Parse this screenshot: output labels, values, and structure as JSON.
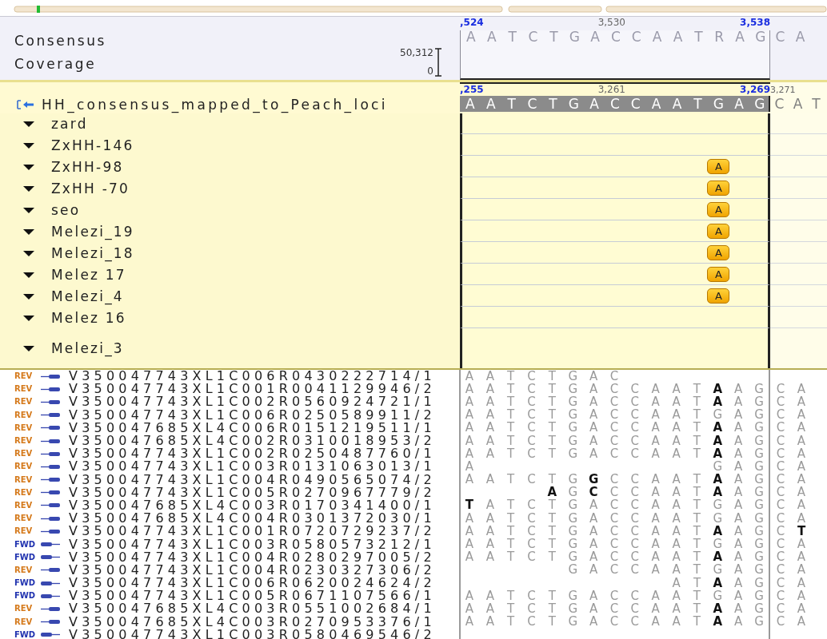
{
  "consensus": {
    "label": "Consensus",
    "coverage_label": "Coverage",
    "coverage_max": "50,312",
    "coverage_min": "0",
    "ruler": [
      {
        "label": ",524",
        "kind": "major"
      },
      {
        "label": "3,530",
        "kind": "minor"
      },
      {
        "label": "3,538",
        "kind": "major"
      }
    ],
    "sequence": "A A T C T G A C C A A T R A G",
    "overhang": "C A"
  },
  "reference": {
    "name": "HH_consensus_mapped_to_Peach_loci",
    "ruler": [
      {
        "label": ",255",
        "kind": "major"
      },
      {
        "label": "3,261",
        "kind": "minor"
      },
      {
        "label": "3,269",
        "kind": "major"
      }
    ],
    "overhang_ruler": "3,271",
    "sequence": "A A T C T G A C C A A T G A G",
    "overhang": "C A T"
  },
  "samples": [
    {
      "name": "zard",
      "expanded": true
    },
    {
      "name": "ZxHH-146",
      "expanded": true
    },
    {
      "name": "ZxHH-98",
      "expanded": true,
      "calls": "                        A"
    },
    {
      "name": "ZxHH -70",
      "expanded": true,
      "calls": "                        A"
    },
    {
      "name": "seo",
      "expanded": true,
      "calls": "                        A"
    },
    {
      "name": "Melezi_19",
      "expanded": true,
      "calls": "                        A"
    },
    {
      "name": "Melezi_18",
      "expanded": true,
      "calls": "                        A"
    },
    {
      "name": "Melez 17",
      "expanded": true,
      "calls": "                        A"
    },
    {
      "name": "Melezi_4",
      "expanded": true,
      "calls": "                        A"
    },
    {
      "name": "Melez 16",
      "expanded": true
    },
    {
      "name": "Melezi_3",
      "expanded": true
    }
  ],
  "reads": [
    {
      "strand": "REV",
      "kind": "reverse",
      "name": "V350047743XL1C006R0430222714/1",
      "bases": [
        "A A T C T G A C"
      ]
    },
    {
      "strand": "REV",
      "kind": "reverse",
      "name": "V350047743XL1C001R0041129946/2",
      "bases": [
        "A A T C T G A C C A A T **A** A G"
      ],
      "overhang": "C A"
    },
    {
      "strand": "REV",
      "kind": "reverse",
      "name": "V350047743XL1C002R0560924721/1",
      "bases": [
        "A A T C T G A C C A A T **A** A G"
      ],
      "overhang": "C A"
    },
    {
      "strand": "REV",
      "kind": "reverse",
      "name": "V350047743XL1C006R0250589911/2",
      "bases": [
        "A A T C T G A C C A A T G A G"
      ],
      "overhang": "C A"
    },
    {
      "strand": "REV",
      "kind": "reverse",
      "name": "V350047685XL4C006R0151219511/1",
      "bases": [
        "A A T C T G A C C A A T **A** A G"
      ],
      "overhang": "C A"
    },
    {
      "strand": "REV",
      "kind": "reverse",
      "name": "V350047685XL4C002R0310018953/2",
      "bases": [
        "A A T C T G A C C A A T **A** A G"
      ],
      "overhang": "C A"
    },
    {
      "strand": "REV",
      "kind": "reverse",
      "name": "V350047743XL1C002R0250487760/1",
      "bases": [
        "A A T C T G A C C A A T **A** A G"
      ],
      "overhang": "C A"
    },
    {
      "strand": "REV",
      "kind": "reverse",
      "name": "V350047743XL1C003R0131063013/1",
      "bases": [
        "A",
        "                      G A G"
      ],
      "overhang": "C A"
    },
    {
      "strand": "REV",
      "kind": "reverse",
      "name": "V350047743XL1C004R0490565074/2",
      "bases": [
        "A A T C T G **G** C C A A T **A** A G"
      ],
      "overhang": "C A"
    },
    {
      "strand": "REV",
      "kind": "reverse",
      "name": "V350047743XL1C005R0270967779/2",
      "bases": [
        "        **A** G **C** C C A A T **A** A G"
      ],
      "overhang": "C A"
    },
    {
      "strand": "REV",
      "kind": "reverse",
      "name": "V350047685XL4C003R0170341400/1",
      "bases": [
        "**T** A T C T G A C C A A T G A G"
      ],
      "overhang": "C A"
    },
    {
      "strand": "REV",
      "kind": "reverse",
      "name": "V350047685XL4C004R0301372030/1",
      "bases": [
        "A A T C T G A C C A A T G A G"
      ],
      "overhang": "C A"
    },
    {
      "strand": "REV",
      "kind": "reverse",
      "name": "V350047743XL1C001R0720729237/2",
      "bases": [
        "A A T C T G A C C A A T **A** A G"
      ],
      "overhang": "C **T**"
    },
    {
      "strand": "FWD",
      "kind": "forward",
      "name": "V350047743XL1C003R0580573212/1",
      "bases": [
        "A A T C T G A C C A A T G A G"
      ],
      "overhang": "C A"
    },
    {
      "strand": "FWD",
      "kind": "forward",
      "name": "V350047743XL1C004R0280297005/2",
      "bases": [
        "A A T C T G A C C A A T **A** A G"
      ],
      "overhang": "C A"
    },
    {
      "strand": "REV",
      "kind": "reverse",
      "name": "V350047743XL1C004R0230327306/2",
      "bases": [
        "          G A C C A A T G A G"
      ],
      "overhang": "C A"
    },
    {
      "strand": "FWD",
      "kind": "forward",
      "name": "V350047743XL1C006R0620024624/2",
      "bases": [
        "                    A T **A** A G"
      ],
      "overhang": "C A"
    },
    {
      "strand": "FWD",
      "kind": "forward",
      "name": "V350047743XL1C005R0671107566/1",
      "bases": [
        "A A T C T G A C C A A T G A G"
      ],
      "overhang": "C A"
    },
    {
      "strand": "REV",
      "kind": "reverse",
      "name": "V350047685XL4C003R0551002684/1",
      "bases": [
        "A A T C T G A C C A A T **A** A G"
      ],
      "overhang": "C A"
    },
    {
      "strand": "REV",
      "kind": "reverse",
      "name": "V350047685XL4C003R0270953376/1",
      "bases": [
        "A A T C T G A C C A A T **A** A G"
      ],
      "overhang": "C A"
    },
    {
      "strand": "FWD",
      "kind": "forward",
      "name": "V350047743XL1C003R0580469546/2"
    }
  ]
}
